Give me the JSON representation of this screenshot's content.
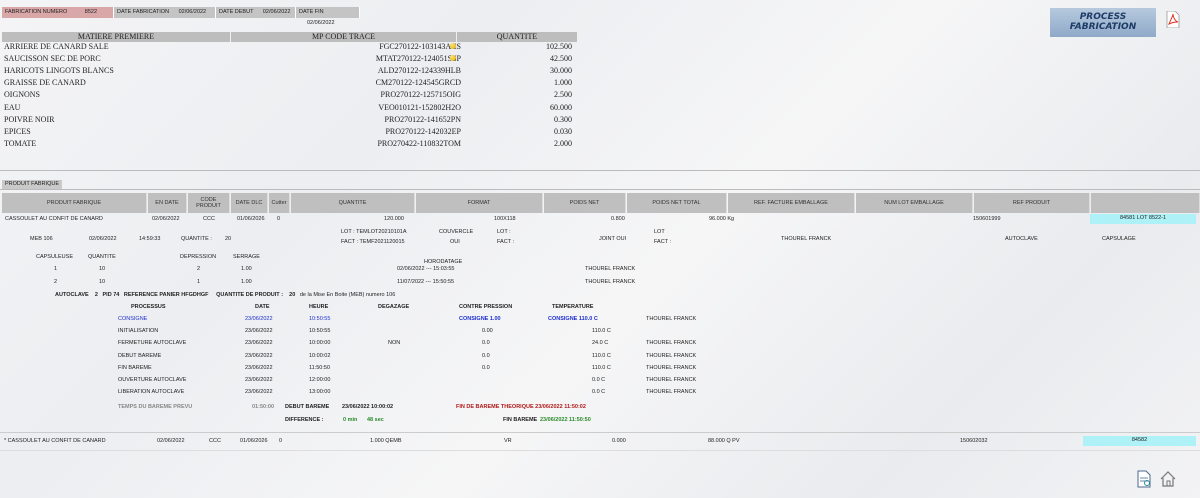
{
  "header": {
    "fab_num_label": "FABRICATION NUMERO",
    "fab_num_value": "8522",
    "date_fab_label": "DATE FABRICATION",
    "date_fab_value": "02/06/2022",
    "date_debut_label": "DATE DEBUT",
    "date_debut_value": "02/06/2022",
    "date_fin_label": "DATE FIN",
    "date_fin_value": "02/06/2022"
  },
  "logo": {
    "line1": "PROCESS",
    "line2": "FABRICATION"
  },
  "icons": {
    "pdf": "pdf-icon",
    "report": "report-icon",
    "home": "home-icon",
    "status": "yellow-dot-icon"
  },
  "materials": {
    "headers": [
      "MATIERE PREMIERE",
      "MP CODE TRACE",
      "QUANTITE"
    ],
    "rows": [
      {
        "name": "ARRIERE DE CANARD SALE",
        "code": "FGC270122-103143ACS",
        "dot": true,
        "qty": "102.500"
      },
      {
        "name": "SAUCISSON SEC DE PORC",
        "code": "MTAT270122-124051SSP",
        "dot": true,
        "qty": "42.500"
      },
      {
        "name": "HARICOTS LINGOTS BLANCS",
        "code": "ALD270122-124339HLB",
        "dot": false,
        "qty": "30.000"
      },
      {
        "name": "GRAISSE DE CANARD",
        "code": "CM270122-124545GRCD",
        "dot": false,
        "qty": "1.000"
      },
      {
        "name": "OIGNONS",
        "code": "PRO270122-125715OIG",
        "dot": false,
        "qty": "2.500"
      },
      {
        "name": "EAU",
        "code": "VEO010121-152802H2O",
        "dot": false,
        "qty": "60.000"
      },
      {
        "name": "POIVRE NOIR",
        "code": "PRO270122-141652PN",
        "dot": false,
        "qty": "0.300"
      },
      {
        "name": "EPICES",
        "code": "PRO270122-142032EP",
        "dot": false,
        "qty": "0.030"
      },
      {
        "name": "TOMATE",
        "code": "PRO270422-110832TOM",
        "dot": false,
        "qty": "2.000"
      }
    ]
  },
  "product": {
    "section_label": "PRODUIT FABRIQUE",
    "headers": [
      "PRODUIT FABRIQUE",
      "EN DATE",
      "CODE PRODUIT",
      "DATE DLC",
      "Cutter",
      "QUANTITE",
      "FORMAT",
      "POIDS NET",
      "POIDS NET TOTAL",
      "REF. FACTURE EMBALLAGE",
      "NUM LOT EMBALLAGE",
      "REF PRODUIT",
      ""
    ],
    "row": {
      "name": "CASSOULET AU CONFIT DE CANARD",
      "date": "02/06/2022",
      "code": "CCC",
      "dlc": "01/06/2026",
      "cutter": "0",
      "qty": "120.000",
      "format": "100X118",
      "poids": "0.800",
      "poids_total": "96.000 Kg",
      "ref": "150601999",
      "lot": "84581 LOT 8522-1"
    },
    "meb": {
      "meb": "MEB 106",
      "date": "02/06/2022",
      "time": "14:59:33",
      "qty_label": "QUANTITE :",
      "qty": "20"
    },
    "lot_fact": {
      "lot_label": "LOT :",
      "lot_value": "TEMLOT20210101A",
      "fact_label": "FACT :",
      "fact_value": "TEMF2021120015",
      "couvercle_label": "COUVERCLE",
      "couvercle_value": "OUI",
      "lot2": "LOT :",
      "fact2": "FACT :",
      "joint": "JOINT OUI",
      "lot3": "LOT",
      "fact3": "FACT :",
      "operator": "THOUREL FRANCK",
      "autoclave": "AUTOCLAVE",
      "capsulage": "CAPSULAGE"
    },
    "caps_headers": {
      "capsuleuse": "CAPSULEUSE",
      "quantite": "QUANTITE",
      "depression": "DEPRESSION",
      "serrage": "SERRAGE",
      "horodatage": "HORODATAGE"
    },
    "caps_rows": [
      {
        "c": "1",
        "q": "10",
        "d": "2",
        "s": "1.00",
        "h": "02/06/2022 --- 15:03:55",
        "op": "THOUREL FRANCK"
      },
      {
        "c": "2",
        "q": "10",
        "d": "1",
        "s": "1.00",
        "h": "11/07/2022 --- 15:50:55",
        "op": "THOUREL FRANCK"
      }
    ],
    "autoclave_line": {
      "a": "AUTOCLAVE",
      "a_num": "2",
      "pid": "PID 74",
      "ref": "REFERENCE PANIER HFGDHGF",
      "qty_label": "QUANTITE DE PRODUIT :",
      "qty": "20",
      "meb": "de la Mise En Boite (MEB) numero 106"
    },
    "process_headers": {
      "p": "PROCESSUS",
      "date": "DATE",
      "heure": "HEURE",
      "degazage": "DEGAZAGE",
      "cp": "CONTRE PRESSION",
      "temp": "TEMPERATURE"
    },
    "process_rows": [
      {
        "p": "CONSIGNE",
        "date": "23/06/2022",
        "heure": "10:50:55",
        "deg": "",
        "cp": "CONSIGNE 1.00",
        "temp": "CONSIGNE 110.0 C",
        "op": "THOUREL FRANCK"
      },
      {
        "p": "INITIALISATION",
        "date": "23/06/2022",
        "heure": "10:50:55",
        "deg": "",
        "cp": "0.00",
        "temp": "110.0 C",
        "op": ""
      },
      {
        "p": "FERMETURE AUTOCLAVE",
        "date": "23/06/2022",
        "heure": "10:00:00",
        "deg": "NON",
        "cp": "0.0",
        "temp": "24.0 C",
        "op": "THOUREL FRANCK"
      },
      {
        "p": "DEBUT BAREME",
        "date": "23/06/2022",
        "heure": "10:00:02",
        "deg": "",
        "cp": "0.0",
        "temp": "110.0 C",
        "op": "THOUREL FRANCK"
      },
      {
        "p": "FIN BAREME",
        "date": "23/06/2022",
        "heure": "11:50:50",
        "deg": "",
        "cp": "0.0",
        "temp": "110.0 C",
        "op": "THOUREL FRANCK"
      },
      {
        "p": "OUVERTURE AUTOCLAVE",
        "date": "23/06/2022",
        "heure": "12:00:00",
        "deg": "",
        "cp": "",
        "temp": "0.0 C",
        "op": "THOUREL FRANCK"
      },
      {
        "p": "LIBERATION AUTOCLAVE",
        "date": "23/06/2022",
        "heure": "13:00:00",
        "deg": "",
        "cp": "",
        "temp": "0.0 C",
        "op": "THOUREL FRANCK"
      }
    ],
    "bareme": {
      "tps_label": "TEMPS DU BAREME PREVU",
      "tps_value": "01:50:00",
      "debut_label": "DEBUT BAREME",
      "debut_value": "23/06/2022 10:00:02",
      "fin_theo": "FIN DE BAREME THEORIQUE 23/06/2022 11:50:02",
      "diff_label": "DIFFERENCE :",
      "diff_min": "0 min",
      "diff_sec": "48 sec",
      "fin_label": "FIN BAREME",
      "fin_value": "23/06/2022 11:50:50"
    },
    "footer_row": {
      "name": "* CASSOULET AU CONFIT DE CANARD",
      "date": "02/06/2022",
      "code": "CCC",
      "dlc": "01/06/2026",
      "cutter": "0",
      "qty": "1.000 QEMB",
      "format": "VR",
      "poids": "0.000",
      "poids_total": "88.000 Q PV",
      "ref": "150602032",
      "lot": "84582"
    }
  }
}
